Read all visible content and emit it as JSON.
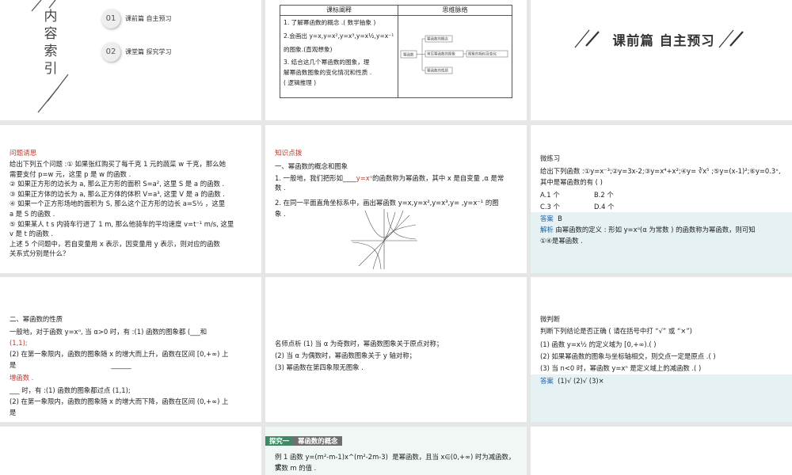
{
  "s1": {
    "title_chars": [
      "内",
      "容",
      "索",
      "引"
    ],
    "items": [
      {
        "num": "01",
        "label": "课前篇 自主预习"
      },
      {
        "num": "02",
        "label": "课堂篇 探究学习"
      }
    ]
  },
  "s2": {
    "col1_header": "课标阐释",
    "col2_header": "思维脉络",
    "lines": [
      "1. 了解幂函数的概念 .( 数学抽象 )",
      "2.会画出 y=x,y=x²,y=x³,y=x½,y=x⁻¹",
      "的图象.(直观想象)",
      "3. 结合这几个幂函数的图象，理",
      "解幂函数图象的变化情况和性质 .",
      "( 逻辑推理 )"
    ],
    "map": {
      "root": "幂函数",
      "n1": "幂函数的概念",
      "n2": "常见幂函数的图象",
      "n3": "幂函数的性质",
      "n4": "图象的相似及变化"
    }
  },
  "s3": {
    "title": "课前篇 自主预习"
  },
  "s4": {
    "header": "问题诱思",
    "lines": [
      "给出下列五个问题 :① 如果张红购买了每千克 1 元的蔬菜 w 千克，那么她",
      "需要支付 p=w 元，这里 p 是 w 的函数 .",
      "② 如果正方形的边长为 a, 那么正方形的面积 S=a², 这里 S 是 a 的函数 .",
      "③ 如果正方体的边长为 a, 那么正方体的体积 V=a³, 这里 V 是 a 的函数 .",
      "④ 如果一个正方形场地的面积为 S, 那么这个正方形的边长 a=S½   ，这里",
      "a 是 S 的函数 .",
      "⑤ 如果某人 t s 内骑车行进了 1 m, 那么他骑车的平均速度 v=t⁻¹ m/s, 这里",
      "v 是 t 的函数 .",
      "上述 5 个问题中，若自变量用 x 表示，因变量用 y 表示，则对应的函数",
      "关系式分别是什么？"
    ]
  },
  "s5": {
    "header": "知识点拨",
    "subtitle": "一、幂函数的概念和图象",
    "l1a": "1. 一般地，我们把形如",
    "l1b": "y=xᵅ",
    "l1c": "的函数称为幂函数，其中 x 是自变量 ,α 是常",
    "l1d": "数 .",
    "l2a": "2. 在同一平面直角坐标系中，画出幂函数 y=x,y=x²,y=x³,y=     ,y=x⁻¹ 的图",
    "l2b": "象 ."
  },
  "s6": {
    "title": "微练习",
    "q1": "给出下列函数 :①y=x⁻³;②y=3x-2;③y=x⁴+x²;④y= ∛x⁵ ;⑤y=(x-1)²;⑥y=0.3ˣ,",
    "q2": "其中是幂函数的有 (      )",
    "opts": [
      "A.1 个",
      "B.2 个",
      "C.3 个",
      "D.4 个"
    ],
    "answer_label": "答案",
    "answer_value": "B",
    "exp_label": "解析",
    "exp_line1": "由幂函数的定义 : 形如 y=xᵅ(α 为常数 ) 的函数称为幂函数，则可知",
    "exp_line2": "①④是幂函数 ."
  },
  "s7": {
    "subtitle": "二、幂函数的性质",
    "l1": "一般地，对于函数 y=xᵅ, 当 α>0 时，有 :(1) 函数的图象都       (___和",
    "l2": "(1,1);",
    "l3": "第一象限内，函数的图象随 x 的增大而上升，函数在区间 [0,+∞) 上",
    "l4": "是",
    "l5": "增函数 .",
    "l6": "___ 时，有 :(1) 函数的图象都过点 (1,1);",
    "l7": "(2) 在第一象限内，函数的图象随 x 的增大而下降，函数在区间 (0,+∞) 上",
    "l8": "是"
  },
  "s8": {
    "lines": [
      "名师点析  (1) 当 α 为奇数时，幂函数图象关于原点对称；",
      "(2) 当 α 为偶数时，幂函数图象关于 y 轴对称；",
      "(3) 幂函数在第四象限无图象 ."
    ]
  },
  "s9": {
    "title": "微判断",
    "q": "判断下列结论是否正确 ( 请在括号中打 “√” 或 “×”)",
    "items": [
      "(1) 函数 y=x½  的定义域为 [0,+∞).(        )",
      "(2) 如果幂函数的图象与坐标轴相交，则交点一定是原点 .(        )",
      "(3) 当 n<0 时，幂函数 y=xⁿ 是定义域上的减函数 .(        )"
    ],
    "answer_label": "答案",
    "answer_value": "(1)√    (2)√    (3)×"
  },
  "s11": {
    "tag": "探究一",
    "tag_title": "幂函数的概念",
    "l1a": "例 1 函数 y=(m²-m-1)x^(m²-2m-3)",
    "l1b": "是幂函数，且当 x∈(0,+∞) 时为减函数，求",
    "l2": "实数 m 的值 ."
  }
}
